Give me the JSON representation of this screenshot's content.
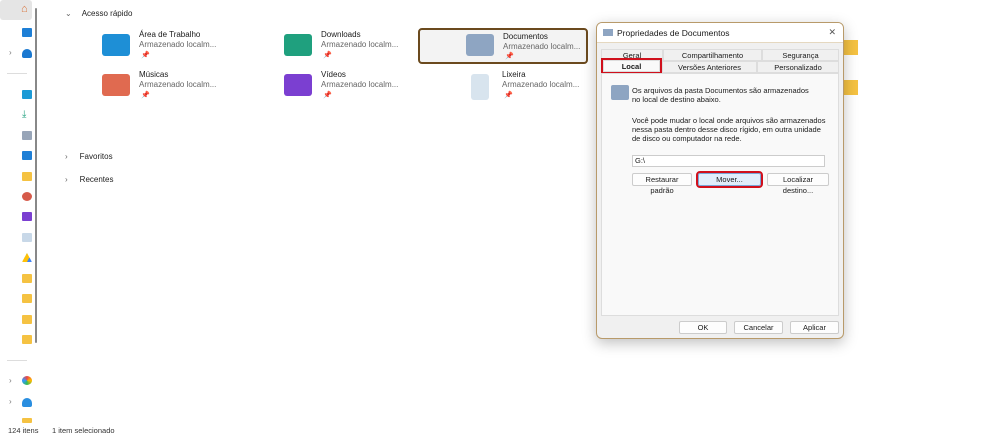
{
  "sidebar": {
    "scrollbar": "vertical"
  },
  "quick_access": {
    "title": "Acesso rápido",
    "items": [
      {
        "name": "Área de Trabalho",
        "sub": "Armazenado localm...",
        "color": "#1e8fd6"
      },
      {
        "name": "Downloads",
        "sub": "Armazenado localm...",
        "color": "#1fa07e"
      },
      {
        "name": "Documentos",
        "sub": "Armazenado localm...",
        "color": "#8ea5c2"
      },
      {
        "name": "Músicas",
        "sub": "Armazenado localm...",
        "color": "#e06a50"
      },
      {
        "name": "Vídeos",
        "sub": "Armazenado localm...",
        "color": "#7b3fd1"
      },
      {
        "name": "Lixeira",
        "sub": "Armazenado localm...",
        "color": "#c8d8e8"
      }
    ]
  },
  "sections": {
    "favoritos": "Favoritos",
    "recentes": "Recentes"
  },
  "status": {
    "count": "124 itens",
    "selected": "1 item selecionado"
  },
  "dialog": {
    "title": "Propriedades de Documentos",
    "close": "✕",
    "tabs_row1": [
      "Geral",
      "Compartilhamento",
      "Segurança"
    ],
    "tabs_row2": [
      "Local",
      "Versões Anteriores",
      "Personalizado"
    ],
    "info1": "Os arquivos da pasta Documentos são armazenados no local de destino abaixo.",
    "info2": "Você pode mudar o local onde arquivos são armazenados nessa pasta dentro desse disco rígido, em outra unidade de disco ou computador na rede.",
    "path": "G:\\",
    "restore": "Restaurar padrão",
    "move": "Mover...",
    "find": "Localizar destino...",
    "ok": "OK",
    "cancel": "Cancelar",
    "apply": "Aplicar"
  }
}
